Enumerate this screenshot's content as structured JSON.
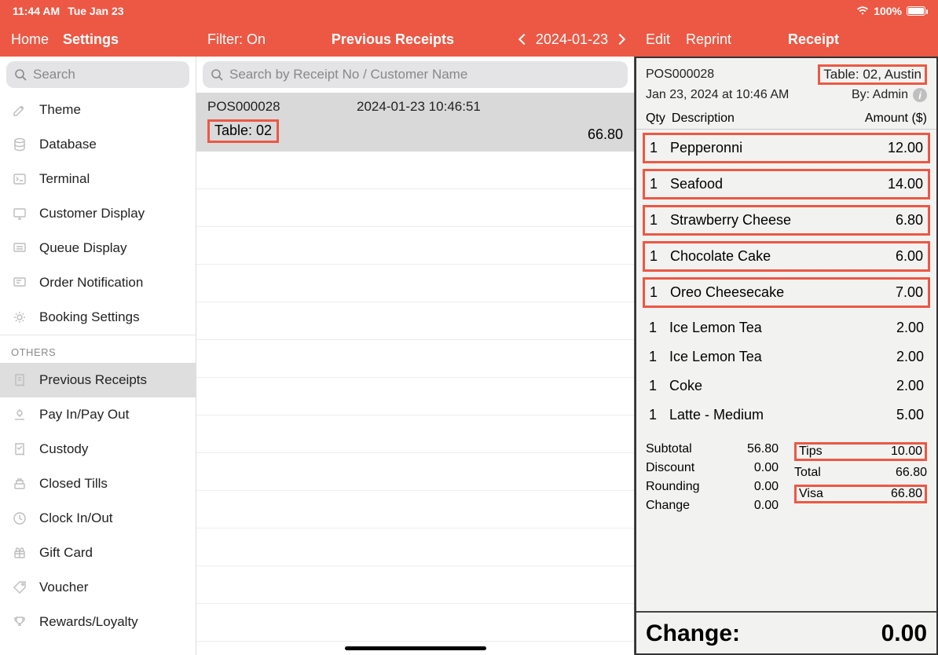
{
  "status": {
    "time": "11:44 AM",
    "date": "Tue Jan 23",
    "battery": "100%"
  },
  "header": {
    "left": {
      "home": "Home",
      "settings": "Settings"
    },
    "mid": {
      "filter": "Filter: On",
      "title": "Previous Receipts",
      "date": "2024-01-23"
    },
    "right": {
      "edit": "Edit",
      "reprint": "Reprint",
      "receipt": "Receipt"
    }
  },
  "sidebar": {
    "search_placeholder": "Search",
    "top_items": [
      {
        "label": "Theme",
        "icon": "brush"
      },
      {
        "label": "Database",
        "icon": "db"
      },
      {
        "label": "Terminal",
        "icon": "terminal"
      },
      {
        "label": "Customer Display",
        "icon": "display"
      },
      {
        "label": "Queue Display",
        "icon": "queue"
      },
      {
        "label": "Order Notification",
        "icon": "order"
      },
      {
        "label": "Booking Settings",
        "icon": "gear"
      }
    ],
    "section": "OTHERS",
    "other_items": [
      {
        "label": "Previous Receipts",
        "icon": "receipt",
        "active": true
      },
      {
        "label": "Pay In/Pay Out",
        "icon": "payio"
      },
      {
        "label": "Custody",
        "icon": "custody"
      },
      {
        "label": "Closed Tills",
        "icon": "till"
      },
      {
        "label": "Clock In/Out",
        "icon": "clock"
      },
      {
        "label": "Gift Card",
        "icon": "gift"
      },
      {
        "label": "Voucher",
        "icon": "tag"
      },
      {
        "label": "Rewards/Loyalty",
        "icon": "trophy"
      }
    ]
  },
  "mid": {
    "search_placeholder": "Search by Receipt No / Customer Name",
    "rows": [
      {
        "id": "POS000028",
        "ts": "2024-01-23 10:46:51",
        "table": "Table: 02",
        "amount": "66.80",
        "selected": true
      }
    ]
  },
  "receipt": {
    "id": "POS000028",
    "table": "Table: 02, Austin",
    "datetime": "Jan 23, 2024 at 10:46 AM",
    "by": "By: Admin",
    "cols": {
      "qty": "Qty",
      "desc": "Description",
      "amt": "Amount ($)"
    },
    "items": [
      {
        "q": "1",
        "d": "Pepperonni",
        "a": "12.00",
        "boxed": true
      },
      {
        "q": "1",
        "d": "Seafood",
        "a": "14.00",
        "boxed": true
      },
      {
        "q": "1",
        "d": "Strawberry Cheese",
        "a": "6.80",
        "boxed": true
      },
      {
        "q": "1",
        "d": "Chocolate Cake",
        "a": "6.00",
        "boxed": true
      },
      {
        "q": "1",
        "d": "Oreo Cheesecake",
        "a": "7.00",
        "boxed": true
      },
      {
        "q": "1",
        "d": "Ice Lemon Tea",
        "a": "2.00",
        "boxed": false
      },
      {
        "q": "1",
        "d": "Ice Lemon Tea",
        "a": "2.00",
        "boxed": false
      },
      {
        "q": "1",
        "d": "Coke",
        "a": "2.00",
        "boxed": false
      },
      {
        "q": "1",
        "d": "Latte - Medium",
        "a": "5.00",
        "boxed": false
      }
    ],
    "summaryA": [
      {
        "k": "Subtotal",
        "v": "56.80"
      },
      {
        "k": "Discount",
        "v": "0.00"
      },
      {
        "k": "Rounding",
        "v": "0.00"
      },
      {
        "k": "Change",
        "v": "0.00"
      }
    ],
    "summaryB": [
      {
        "k": "Tips",
        "v": "10.00",
        "boxed": true
      },
      {
        "k": "Total",
        "v": "66.80",
        "boxed": false
      },
      {
        "k": "Visa",
        "v": "66.80",
        "boxed": true
      }
    ],
    "change_label": "Change:",
    "change_value": "0.00"
  }
}
